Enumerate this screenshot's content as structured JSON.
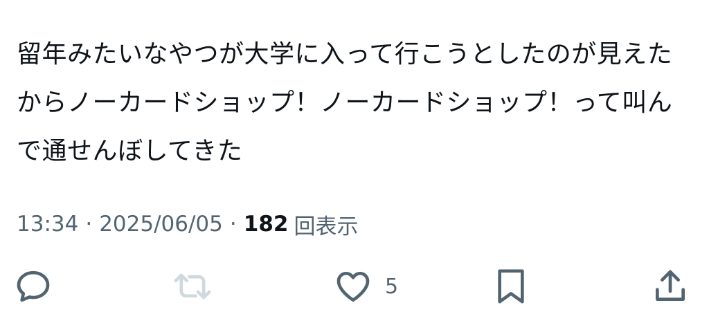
{
  "tweet": {
    "text": "留年みたいなやつが大学に入って行こうとしたのが見えたからノーカードショップ！ノーカードショップ！って叫んで通せんぼしてきた"
  },
  "meta": {
    "time": "13:34",
    "separator": "·",
    "date": "2025/06/05",
    "views_count": "182",
    "views_label": "回表示"
  },
  "actions": {
    "reply_icon": "reply-icon",
    "retweet_icon": "retweet-icon",
    "like_icon": "heart-icon",
    "like_count": "5",
    "bookmark_icon": "bookmark-icon",
    "share_icon": "share-icon"
  },
  "colors": {
    "text": "#0f1419",
    "secondary": "#536471",
    "icon": "#536471",
    "icon_disabled": "#cfd9de",
    "background": "#ffffff"
  }
}
